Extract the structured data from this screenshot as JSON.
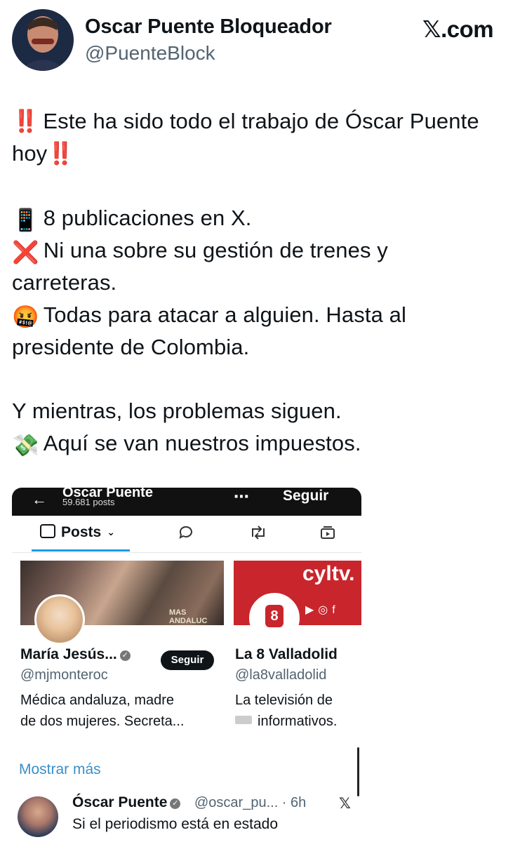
{
  "author": {
    "name": "Oscar Puente Bloqueador",
    "handle": "@PuenteBlock"
  },
  "source_logo": "𝕏.com",
  "tweet_lines": [
    {
      "emoji": "‼️",
      "text": "Este ha sido todo el trabajo de Óscar Puente"
    },
    {
      "text": "hoy",
      "emoji_after": "‼️"
    },
    {
      "emoji": "📱",
      "text": "8 publicaciones en X."
    },
    {
      "emoji": "❌",
      "text": "Ni una sobre su gestión de trenes y"
    },
    {
      "text": "carreteras."
    },
    {
      "emoji": "🤬",
      "text": "Todas para atacar a alguien. Hasta al"
    },
    {
      "text": "presidente de Colombia."
    },
    {
      "text": "Y mientras, los problemas siguen."
    },
    {
      "emoji": "💸",
      "text": "Aquí se van nuestros impuestos."
    }
  ],
  "embedded": {
    "profile_name": "Óscar Puente",
    "posts_count": "59.681 posts",
    "more_icon": "⋯",
    "follow_label": "Seguir",
    "tabs": {
      "posts_label": "Posts",
      "replies_icon": "speech-bubble-icon",
      "reposts_icon": "repost-icon",
      "media_icon": "video-icon"
    },
    "cards": [
      {
        "name": "María Jesús...",
        "handle": "@mjmonteroc",
        "follow_label": "Seguir",
        "bio": [
          "Médica andaluza, madre",
          "de dos mujeres. Secreta..."
        ],
        "banner_text": "MAS ANDALUC"
      },
      {
        "name": "La 8 Valladolid",
        "handle": "@la8valladolid",
        "bio": [
          "La televisión de",
          "informativos."
        ],
        "banner_text": "cyltv."
      }
    ],
    "show_more": "Mostrar más",
    "tweet": {
      "name": "Óscar Puente",
      "meta": "@oscar_pu... · 6h",
      "text": "Si el periodismo está en estado"
    }
  }
}
